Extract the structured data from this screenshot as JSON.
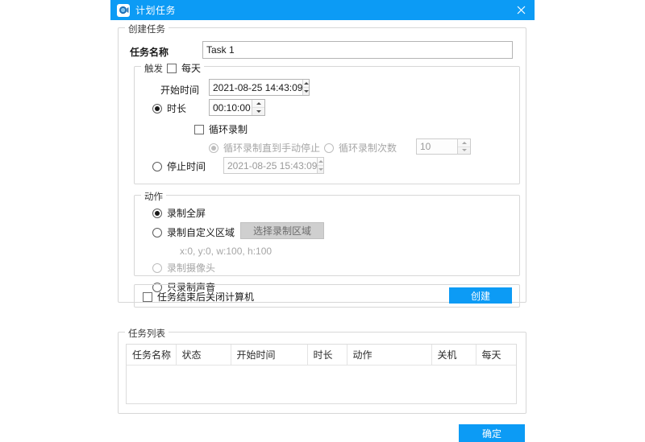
{
  "window": {
    "title": "计划任务",
    "icon": "schedule-task-icon",
    "close_icon": "close-icon",
    "accent_color": "#0c9bf5"
  },
  "create_group": {
    "title": "创建任务",
    "task_name_label": "任务名称",
    "task_name_value": "Task 1",
    "task_name_placeholder": ""
  },
  "trigger_group": {
    "title": "触发",
    "daily_checkbox_label": "每天",
    "daily_checked": false,
    "start_time_label": "开始时间",
    "start_time_value": "2021-08-25 14:43:09",
    "duration_radio_label": "时长",
    "duration_radio_checked": true,
    "duration_value": "00:10:00",
    "loop_record_checkbox_label": "循环录制",
    "loop_record_checked": false,
    "loop_until_stop_label": "循环录制直到手动停止",
    "loop_until_stop_checked": true,
    "loop_count_label": "循环录制次数",
    "loop_count_checked": false,
    "loop_count_value": "10",
    "stop_time_radio_label": "停止时间",
    "stop_time_radio_checked": false,
    "stop_time_value": "2021-08-25 15:43:09"
  },
  "action_group": {
    "title": "动作",
    "fullscreen_label": "录制全屏",
    "fullscreen_checked": true,
    "custom_area_label": "录制自定义区域",
    "custom_area_checked": false,
    "select_area_button": "选择录制区域",
    "area_info": "x:0, y:0, w:100, h:100",
    "webcam_label": "录制摄像头",
    "webcam_checked": false,
    "audio_only_label": "只录制声音",
    "audio_only_checked": false
  },
  "bottom_row": {
    "shutdown_checkbox_label": "任务结束后关闭计算机",
    "shutdown_checked": false,
    "create_button": "创建"
  },
  "task_list": {
    "title": "任务列表",
    "columns": [
      "任务名称",
      "状态",
      "开始时间",
      "时长",
      "动作",
      "关机",
      "每天"
    ],
    "rows": []
  },
  "footer": {
    "ok_button": "确定"
  }
}
